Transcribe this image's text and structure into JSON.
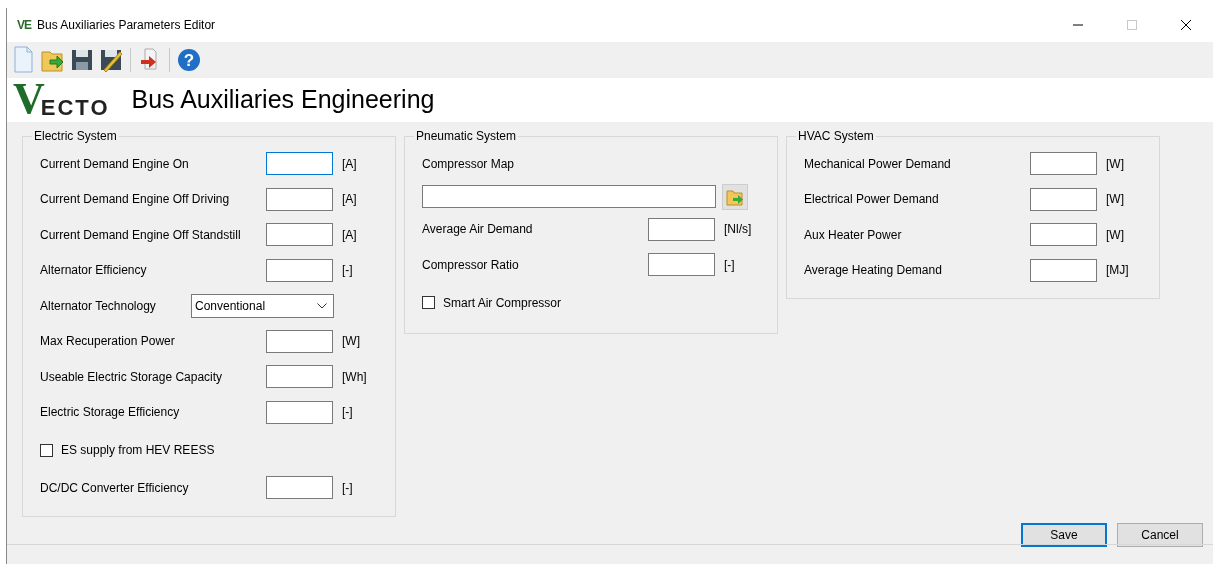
{
  "window": {
    "icon_text": "VE",
    "title": "Bus Auxiliaries Parameters Editor",
    "controls": [
      {
        "kind": "minimize",
        "disabled": false
      },
      {
        "kind": "maximize",
        "disabled": true
      },
      {
        "kind": "close",
        "disabled": false
      }
    ]
  },
  "toolbar": [
    {
      "kind": "new"
    },
    {
      "kind": "open"
    },
    {
      "kind": "save"
    },
    {
      "kind": "save_as"
    },
    {
      "kind": "separator"
    },
    {
      "kind": "export"
    },
    {
      "kind": "separator"
    },
    {
      "kind": "help",
      "glyph": "?"
    }
  ],
  "header": {
    "logo_initial": "V",
    "logo_rest": "ECTO",
    "title": "Bus Auxiliaries Engineering"
  },
  "groups": [
    {
      "title": "Electric System",
      "rows": [
        {
          "kind": "field",
          "label": "Current Demand Engine On",
          "unit": "[A]",
          "focused": true
        },
        {
          "kind": "field",
          "label": "Current Demand Engine Off Driving",
          "unit": "[A]",
          "focused": false
        },
        {
          "kind": "field",
          "label": "Current Demand Engine Off Standstill",
          "unit": "[A]",
          "focused": false
        },
        {
          "kind": "field",
          "label": "Alternator Efficiency",
          "unit": "[-]",
          "focused": false
        },
        {
          "kind": "select",
          "label": "Alternator Technology",
          "value": "Conventional"
        },
        {
          "kind": "field",
          "label": "Max Recuperation Power",
          "unit": "[W]",
          "focused": false
        },
        {
          "kind": "field",
          "label": "Useable Electric Storage Capacity",
          "unit": "[Wh]",
          "focused": false
        },
        {
          "kind": "field",
          "label": "Electric Storage Efficiency",
          "unit": "[-]",
          "focused": false
        },
        {
          "kind": "checkbox",
          "label": "ES supply from HEV REESS",
          "checked": false
        },
        {
          "kind": "field",
          "label": "DC/DC Converter Efficiency",
          "unit": "[-]",
          "focused": false
        }
      ]
    },
    {
      "title": "Pneumatic System",
      "rows": [
        {
          "kind": "file",
          "label": "Compressor Map"
        },
        {
          "kind": "field",
          "label": "Average Air Demand",
          "unit": "[Nl/s]",
          "focused": false
        },
        {
          "kind": "field",
          "label": "Compressor Ratio",
          "unit": "[-]",
          "focused": false
        },
        {
          "kind": "checkbox",
          "label": "Smart Air Compressor",
          "checked": false
        }
      ]
    },
    {
      "title": "HVAC System",
      "rows": [
        {
          "kind": "field",
          "label": "Mechanical Power Demand",
          "unit": "[W]",
          "focused": false
        },
        {
          "kind": "field",
          "label": "Electrical Power Demand",
          "unit": "[W]",
          "focused": false
        },
        {
          "kind": "field",
          "label": "Aux Heater Power",
          "unit": "[W]",
          "focused": false
        },
        {
          "kind": "field",
          "label": "Average Heating Demand",
          "unit": "[MJ]",
          "focused": false
        }
      ]
    }
  ],
  "buttons": [
    {
      "label": "Save",
      "default": true
    },
    {
      "label": "Cancel",
      "default": false
    }
  ]
}
